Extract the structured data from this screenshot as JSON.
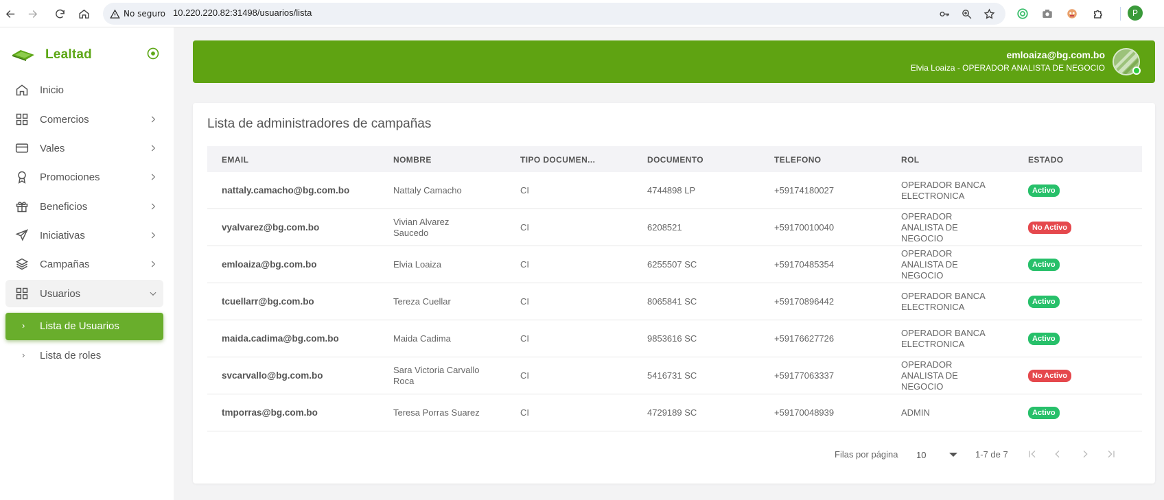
{
  "browser": {
    "not_secure_label": "No seguro",
    "url": "10.220.220.82:31498/usuarios/lista",
    "profile_initial": "P"
  },
  "sidebar": {
    "brand_name": "Lealtad",
    "items": [
      {
        "label": "Inicio",
        "icon": "home-icon"
      },
      {
        "label": "Comercios",
        "icon": "grid-icon"
      },
      {
        "label": "Vales",
        "icon": "card-icon"
      },
      {
        "label": "Promociones",
        "icon": "award-icon"
      },
      {
        "label": "Beneficios",
        "icon": "gift-icon"
      },
      {
        "label": "Iniciativas",
        "icon": "send-icon"
      },
      {
        "label": "Campañas",
        "icon": "layers-icon"
      },
      {
        "label": "Usuarios",
        "icon": "grid-icon"
      }
    ],
    "sub_items": [
      {
        "label": "Lista de Usuarios"
      },
      {
        "label": "Lista de roles"
      }
    ]
  },
  "header": {
    "email": "emloaiza@bg.com.bo",
    "user_line": "Elvia Loaiza - OPERADOR ANALISTA DE NEGOCIO"
  },
  "main": {
    "title": "Lista de administradores de campañas",
    "columns": [
      "EMAIL",
      "NOMBRE",
      "TIPO DOCUMEN...",
      "DOCUMENTO",
      "TELEFONO",
      "ROL",
      "ESTADO"
    ],
    "rows": [
      {
        "email": "nattaly.camacho@bg.com.bo",
        "nombre": [
          "Nattaly Camacho"
        ],
        "tipo": "CI",
        "documento": "4744898 LP",
        "telefono": "+59174180027",
        "rol": [
          "OPERADOR BANCA",
          "ELECTRONICA"
        ],
        "estado": "Activo",
        "activo": true
      },
      {
        "email": "vyalvarez@bg.com.bo",
        "nombre": [
          "Vivian Alvarez",
          "Saucedo"
        ],
        "tipo": "CI",
        "documento": "6208521",
        "telefono": "+59170010040",
        "rol": [
          "OPERADOR",
          "ANALISTA DE",
          "NEGOCIO"
        ],
        "estado": "No Activo",
        "activo": false
      },
      {
        "email": "emloaiza@bg.com.bo",
        "nombre": [
          "Elvia Loaiza"
        ],
        "tipo": "CI",
        "documento": "6255507 SC",
        "telefono": "+59170485354",
        "rol": [
          "OPERADOR",
          "ANALISTA DE",
          "NEGOCIO"
        ],
        "estado": "Activo",
        "activo": true
      },
      {
        "email": "tcuellarr@bg.com.bo",
        "nombre": [
          "Tereza Cuellar"
        ],
        "tipo": "CI",
        "documento": "8065841 SC",
        "telefono": "+59170896442",
        "rol": [
          "OPERADOR BANCA",
          "ELECTRONICA"
        ],
        "estado": "Activo",
        "activo": true
      },
      {
        "email": "maida.cadima@bg.com.bo",
        "nombre": [
          "Maida Cadima"
        ],
        "tipo": "CI",
        "documento": "9853616 SC",
        "telefono": "+59176627726",
        "rol": [
          "OPERADOR BANCA",
          "ELECTRONICA"
        ],
        "estado": "Activo",
        "activo": true
      },
      {
        "email": "svcarvallo@bg.com.bo",
        "nombre": [
          "Sara Victoria Carvallo",
          "Roca"
        ],
        "tipo": "CI",
        "documento": "5416731 SC",
        "telefono": "+59177063337",
        "rol": [
          "OPERADOR",
          "ANALISTA DE",
          "NEGOCIO"
        ],
        "estado": "No Activo",
        "activo": false
      },
      {
        "email": "tmporras@bg.com.bo",
        "nombre": [
          "Teresa Porras Suarez"
        ],
        "tipo": "CI",
        "documento": "4729189 SC",
        "telefono": "+59170048939",
        "rol": [
          "ADMIN"
        ],
        "estado": "Activo",
        "activo": true
      }
    ]
  },
  "pagination": {
    "rows_per_page_label": "Filas por página",
    "rows_per_page_value": "10",
    "range_label": "1-7 de 7"
  },
  "colors": {
    "brand_green": "#5fa312",
    "active_badge": "#27c06a",
    "inactive_badge": "#e5484d"
  }
}
